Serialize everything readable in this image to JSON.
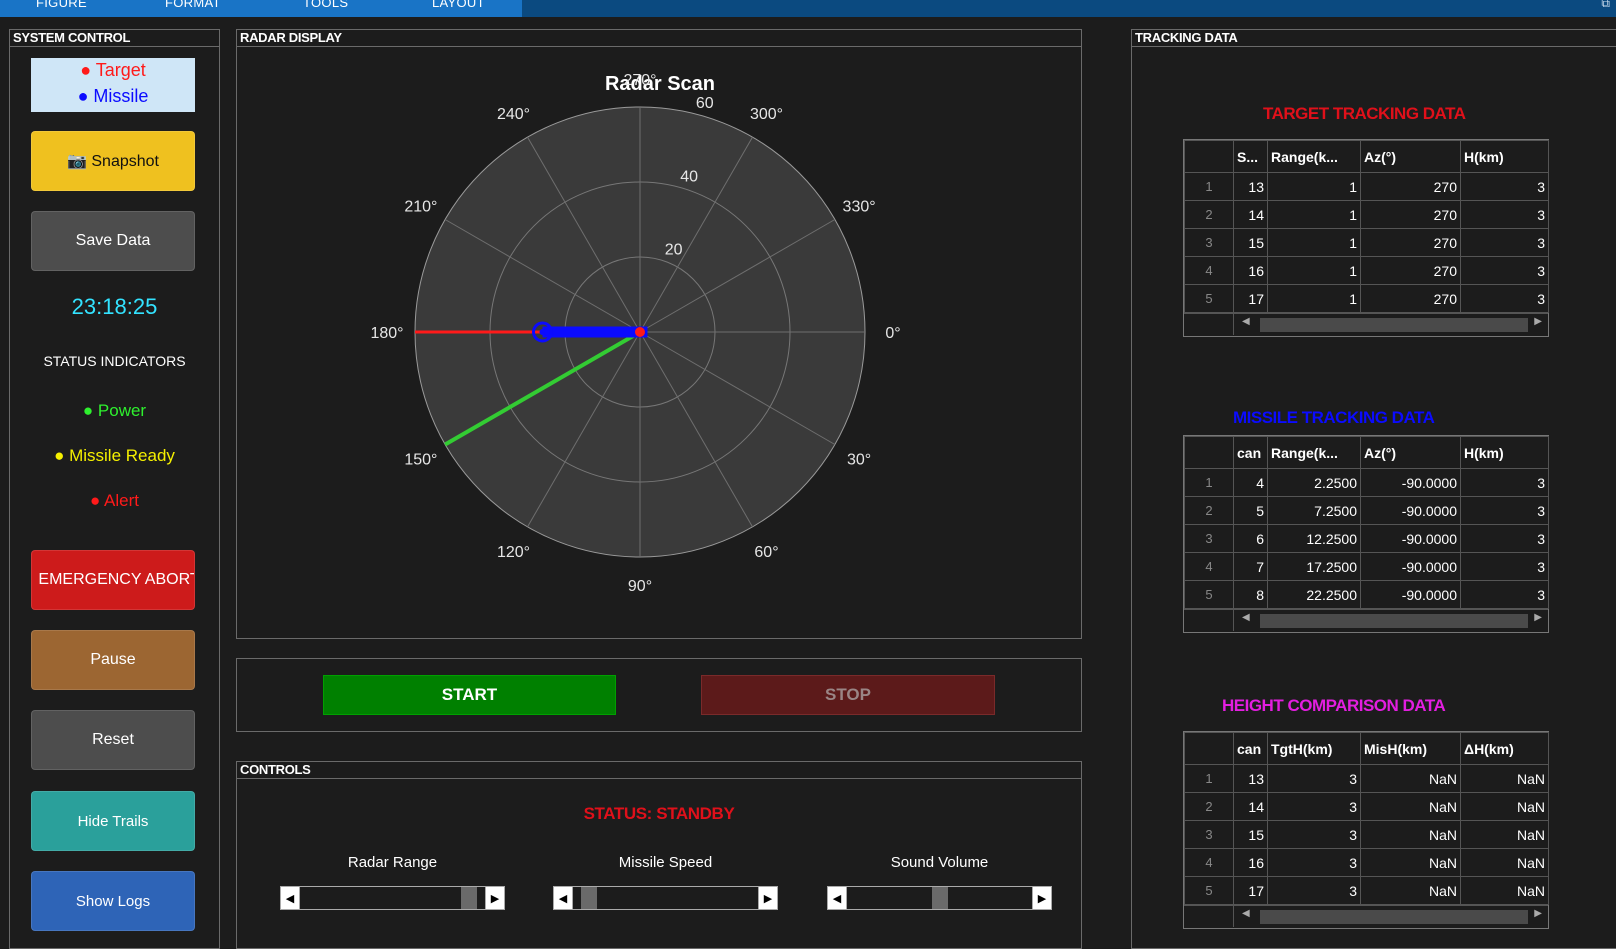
{
  "menu": {
    "items": [
      "FIGURE",
      "FORMAT",
      "TOOLS",
      "LAYOUT"
    ]
  },
  "system_control": {
    "title": "SYSTEM CONTROL",
    "legend": {
      "target": "● Target",
      "missile": "● Missile"
    },
    "buttons": {
      "snapshot": "📷 Snapshot",
      "save_data": "Save Data",
      "emergency_abort": "EMERGENCY ABORT",
      "pause": "Pause",
      "reset": "Reset",
      "hide_trails": "Hide Trails",
      "show_logs": "Show Logs"
    },
    "clock": "23:18:25",
    "status_heading": "STATUS INDICATORS",
    "indicators": {
      "power": "● Power",
      "missile_ready": "● Missile Ready",
      "alert": "● Alert"
    }
  },
  "radar": {
    "panel_title": "RADAR DISPLAY",
    "title": "Radar Scan",
    "angle_labels": [
      "0°",
      "30°",
      "60°",
      "90°",
      "120°",
      "150°",
      "180°",
      "210°",
      "240°",
      "270°",
      "300°",
      "330°"
    ],
    "range_labels": [
      "20",
      "40",
      "60"
    ],
    "max_range": 60,
    "target_trail_endpoint": {
      "range": 60,
      "angle": 180
    },
    "missile_trail": {
      "from_range": 2,
      "to_range": 26,
      "angle": 180
    },
    "sweep_angle": 150,
    "colors": {
      "target": "#ff1a1a",
      "missile": "#0b0bff",
      "sweep": "#33cc33",
      "grid": "#8a8a8a"
    }
  },
  "control_buttons": {
    "start": "START",
    "stop": "STOP"
  },
  "controls": {
    "panel_title": "CONTROLS",
    "status": "STATUS: STANDBY",
    "sliders": [
      {
        "label": "Radar Range",
        "value": 0.95
      },
      {
        "label": "Missile Speed",
        "value": 0.05
      },
      {
        "label": "Sound Volume",
        "value": 0.5
      }
    ]
  },
  "tracking": {
    "panel_title": "TRACKING DATA",
    "target": {
      "title": "TARGET TRACKING DATA",
      "headers": [
        "S...",
        "Range(k...",
        "Az(°)",
        "H(km)"
      ],
      "rows": [
        [
          "1",
          "13",
          "1",
          "270",
          "3"
        ],
        [
          "2",
          "14",
          "1",
          "270",
          "3"
        ],
        [
          "3",
          "15",
          "1",
          "270",
          "3"
        ],
        [
          "4",
          "16",
          "1",
          "270",
          "3"
        ],
        [
          "5",
          "17",
          "1",
          "270",
          "3"
        ]
      ]
    },
    "missile": {
      "title": "MISSILE TRACKING DATA",
      "headers": [
        "can",
        "Range(k...",
        "Az(°)",
        "H(km)"
      ],
      "rows": [
        [
          "1",
          "4",
          "2.2500",
          "-90.0000",
          "3"
        ],
        [
          "2",
          "5",
          "7.2500",
          "-90.0000",
          "3"
        ],
        [
          "3",
          "6",
          "12.2500",
          "-90.0000",
          "3"
        ],
        [
          "4",
          "7",
          "17.2500",
          "-90.0000",
          "3"
        ],
        [
          "5",
          "8",
          "22.2500",
          "-90.0000",
          "3"
        ]
      ]
    },
    "height": {
      "title": "HEIGHT COMPARISON DATA",
      "headers": [
        "can",
        "TgtH(km)",
        "MisH(km)",
        "ΔH(km)"
      ],
      "rows": [
        [
          "1",
          "13",
          "3",
          "NaN",
          "NaN"
        ],
        [
          "2",
          "14",
          "3",
          "NaN",
          "NaN"
        ],
        [
          "3",
          "15",
          "3",
          "NaN",
          "NaN"
        ],
        [
          "4",
          "16",
          "3",
          "NaN",
          "NaN"
        ],
        [
          "5",
          "17",
          "3",
          "NaN",
          "NaN"
        ]
      ]
    }
  }
}
